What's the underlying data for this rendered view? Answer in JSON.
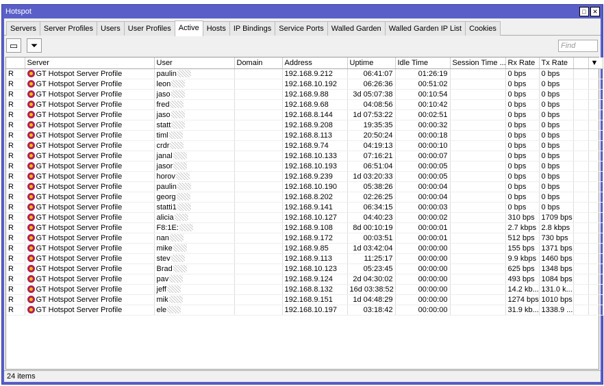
{
  "window": {
    "title": "Hotspot"
  },
  "tabs": [
    "Servers",
    "Server Profiles",
    "Users",
    "User Profiles",
    "Active",
    "Hosts",
    "IP Bindings",
    "Service Ports",
    "Walled Garden",
    "Walled Garden IP List",
    "Cookies"
  ],
  "active_tab": "Active",
  "toolbar": {
    "find_placeholder": "Find"
  },
  "columns": [
    "",
    "Server",
    "User",
    "Domain",
    "Address",
    "Uptime",
    "Idle Time",
    "Session Time ...",
    "Rx Rate",
    "Tx Rate"
  ],
  "rows": [
    [
      "R",
      "GT Hotspot Server Profile",
      "paulin",
      "",
      "192.168.9.212",
      "06:41:07",
      "01:26:19",
      "",
      "0 bps",
      "0 bps"
    ],
    [
      "R",
      "GT Hotspot Server Profile",
      "leon",
      "",
      "192.168.10.192",
      "06:26:36",
      "00:51:02",
      "",
      "0 bps",
      "0 bps"
    ],
    [
      "R",
      "GT Hotspot Server Profile",
      "jaso",
      "",
      "192.168.9.88",
      "3d 05:07:38",
      "00:10:54",
      "",
      "0 bps",
      "0 bps"
    ],
    [
      "R",
      "GT Hotspot Server Profile",
      "fred",
      "",
      "192.168.9.68",
      "04:08:56",
      "00:10:42",
      "",
      "0 bps",
      "0 bps"
    ],
    [
      "R",
      "GT Hotspot Server Profile",
      "jaso",
      "",
      "192.168.8.144",
      "1d 07:53:22",
      "00:02:51",
      "",
      "0 bps",
      "0 bps"
    ],
    [
      "R",
      "GT Hotspot Server Profile",
      "statt",
      "",
      "192.168.9.208",
      "19:35:35",
      "00:00:32",
      "",
      "0 bps",
      "0 bps"
    ],
    [
      "R",
      "GT Hotspot Server Profile",
      "timl",
      "",
      "192.168.8.113",
      "20:50:24",
      "00:00:18",
      "",
      "0 bps",
      "0 bps"
    ],
    [
      "R",
      "GT Hotspot Server Profile",
      "crdr",
      "",
      "192.168.9.74",
      "04:19:13",
      "00:00:10",
      "",
      "0 bps",
      "0 bps"
    ],
    [
      "R",
      "GT Hotspot Server Profile",
      "janal",
      "",
      "192.168.10.133",
      "07:16:21",
      "00:00:07",
      "",
      "0 bps",
      "0 bps"
    ],
    [
      "R",
      "GT Hotspot Server Profile",
      "jasor",
      "",
      "192.168.10.193",
      "06:51:04",
      "00:00:05",
      "",
      "0 bps",
      "0 bps"
    ],
    [
      "R",
      "GT Hotspot Server Profile",
      "horov",
      "",
      "192.168.9.239",
      "1d 03:20:33",
      "00:00:05",
      "",
      "0 bps",
      "0 bps"
    ],
    [
      "R",
      "GT Hotspot Server Profile",
      "paulin",
      "",
      "192.168.10.190",
      "05:38:26",
      "00:00:04",
      "",
      "0 bps",
      "0 bps"
    ],
    [
      "R",
      "GT Hotspot Server Profile",
      "georg",
      "",
      "192.168.8.202",
      "02:26:25",
      "00:00:04",
      "",
      "0 bps",
      "0 bps"
    ],
    [
      "R",
      "GT Hotspot Server Profile",
      "statti1",
      "",
      "192.168.9.141",
      "06:34:15",
      "00:00:03",
      "",
      "0 bps",
      "0 bps"
    ],
    [
      "R",
      "GT Hotspot Server Profile",
      "alicia",
      "",
      "192.168.10.127",
      "04:40:23",
      "00:00:02",
      "",
      "310 bps",
      "1709 bps"
    ],
    [
      "R",
      "GT Hotspot Server Profile",
      "F8:1E:",
      "",
      "192.168.9.108",
      "8d 00:10:19",
      "00:00:01",
      "",
      "2.7 kbps",
      "2.8 kbps"
    ],
    [
      "R",
      "GT Hotspot Server Profile",
      "nan",
      "",
      "192.168.9.172",
      "00:03:51",
      "00:00:01",
      "",
      "512 bps",
      "730 bps"
    ],
    [
      "R",
      "GT Hotspot Server Profile",
      "mike",
      "",
      "192.168.9.85",
      "1d 03:42:04",
      "00:00:00",
      "",
      "155 bps",
      "1371 bps"
    ],
    [
      "R",
      "GT Hotspot Server Profile",
      "stev",
      "",
      "192.168.9.113",
      "11:25:17",
      "00:00:00",
      "",
      "9.9 kbps",
      "1460 bps"
    ],
    [
      "R",
      "GT Hotspot Server Profile",
      "Brad",
      "",
      "192.168.10.123",
      "05:23:45",
      "00:00:00",
      "",
      "625 bps",
      "1348 bps"
    ],
    [
      "R",
      "GT Hotspot Server Profile",
      "pav",
      "",
      "192.168.9.124",
      "2d 04:30:02",
      "00:00:00",
      "",
      "493 bps",
      "1084 bps"
    ],
    [
      "R",
      "GT Hotspot Server Profile",
      "jeff",
      "",
      "192.168.8.132",
      "16d 03:38:52",
      "00:00:00",
      "",
      "14.2 kb...",
      "131.0 k..."
    ],
    [
      "R",
      "GT Hotspot Server Profile",
      "mik",
      "",
      "192.168.9.151",
      "1d 04:48:29",
      "00:00:00",
      "",
      "1274 bps",
      "1010 bps"
    ],
    [
      "R",
      "GT Hotspot Server Profile",
      "ele",
      "",
      "192.168.10.197",
      "03:18:42",
      "00:00:00",
      "",
      "31.9 kb...",
      "1338.9 ..."
    ]
  ],
  "status": {
    "count": "24 items"
  }
}
